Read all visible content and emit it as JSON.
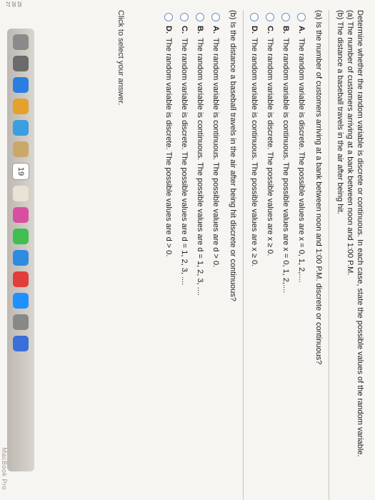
{
  "intro": {
    "line1": "Determine whether the random variable is discrete or continuous. In each case, state the possible values of the random variable.",
    "line2": "(a) The number of customers arriving at a bank between noon and 1:00 P.M.",
    "line3": "(b) The distance a baseball travels in the air after being hit."
  },
  "part_a": {
    "question": "(a) Is the number of customers arriving at a bank between noon and 1:00 P.M. discrete or continuous?",
    "options": [
      {
        "letter": "A.",
        "text": "The random variable is discrete. The possible values are x = 0, 1, 2,...."
      },
      {
        "letter": "B.",
        "text": "The random variable is continuous. The possible values are x = 0, 1, 2,...."
      },
      {
        "letter": "C.",
        "text": "The random variable is discrete. The possible values are x ≥ 0."
      },
      {
        "letter": "D.",
        "text": "The random variable is continuous. The possible values are x ≥ 0."
      }
    ]
  },
  "part_b": {
    "question": "(b) Is the distance a baseball travels in the air after being hit discrete or continuous?",
    "options": [
      {
        "letter": "A.",
        "text": "The random variable is continuous. The possible values are d > 0."
      },
      {
        "letter": "B.",
        "text": "The random variable is continuous. The possible values are d = 1, 2, 3, ...."
      },
      {
        "letter": "C.",
        "text": "The random variable is discrete. The possible values are d = 1, 2, 3, ...."
      },
      {
        "letter": "D.",
        "text": "The random variable is discrete. The possible values are d > 0."
      }
    ]
  },
  "status": "Click to select your answer.",
  "dock": {
    "calendar_day": "19",
    "brand": "MacBook Pro",
    "side_numbers": [
      "25",
      "26",
      "27"
    ]
  },
  "colors": {
    "radio_border": "#6d8fbf",
    "screen_bg": "#f7f5f2"
  }
}
